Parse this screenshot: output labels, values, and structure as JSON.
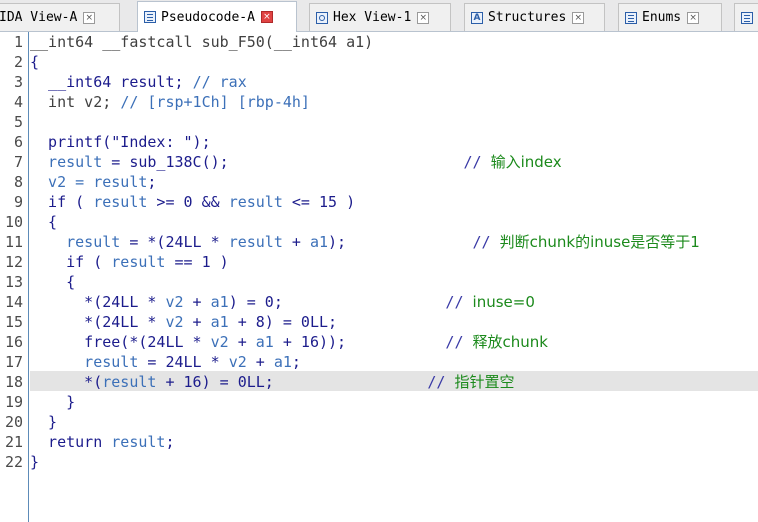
{
  "tabs": [
    {
      "label": "IDA View-A",
      "icon": "none",
      "active": false
    },
    {
      "label": "Pseudocode-A",
      "icon": "document-icon",
      "active": true
    },
    {
      "label": "Hex View-1",
      "icon": "hex-icon",
      "active": false
    },
    {
      "label": "Structures",
      "icon": "structures-icon",
      "active": false
    },
    {
      "label": "Enums",
      "icon": "enums-icon",
      "active": false
    }
  ],
  "code_lines": [
    {
      "n": "1",
      "tokens": [
        {
          "t": "__int64 __fastcall sub_F50(__int64 a1)",
          "c": "muted"
        }
      ]
    },
    {
      "n": "2",
      "tokens": [
        {
          "t": "{",
          "c": "plain"
        }
      ]
    },
    {
      "n": "3",
      "tokens": [
        {
          "t": "  __int64 result; ",
          "c": "plain"
        },
        {
          "t": "// rax",
          "c": "var"
        }
      ]
    },
    {
      "n": "4",
      "tokens": [
        {
          "t": "  int v2; ",
          "c": "muted"
        },
        {
          "t": "// [rsp+1Ch] [rbp-4h]",
          "c": "var"
        }
      ]
    },
    {
      "n": "5",
      "tokens": []
    },
    {
      "n": "6",
      "tokens": [
        {
          "t": "  printf(\"Index: \");",
          "c": "plain"
        }
      ]
    },
    {
      "n": "7",
      "tokens": [
        {
          "t": "  result",
          "c": "var"
        },
        {
          "t": " = sub_138C();",
          "c": "plain"
        },
        {
          "t": "                          // ",
          "c": "com"
        },
        {
          "t": "输入index",
          "c": "cjk"
        }
      ]
    },
    {
      "n": "8",
      "tokens": [
        {
          "t": "  v2 = ",
          "c": "var"
        },
        {
          "t": "result",
          "c": "var"
        },
        {
          "t": ";",
          "c": "plain"
        }
      ]
    },
    {
      "n": "9",
      "tokens": [
        {
          "t": "  if ( ",
          "c": "plain"
        },
        {
          "t": "result",
          "c": "var"
        },
        {
          "t": " >= 0 && ",
          "c": "plain"
        },
        {
          "t": "result",
          "c": "var"
        },
        {
          "t": " <= 15 )",
          "c": "plain"
        }
      ]
    },
    {
      "n": "10",
      "tokens": [
        {
          "t": "  {",
          "c": "plain"
        }
      ]
    },
    {
      "n": "11",
      "tokens": [
        {
          "t": "    result",
          "c": "var"
        },
        {
          "t": " = *(24LL * ",
          "c": "plain"
        },
        {
          "t": "result",
          "c": "var"
        },
        {
          "t": " + ",
          "c": "plain"
        },
        {
          "t": "a1",
          "c": "var"
        },
        {
          "t": ");",
          "c": "plain"
        },
        {
          "t": "              // ",
          "c": "com"
        },
        {
          "t": "判断chunk的inuse是否等于1",
          "c": "cjk"
        }
      ]
    },
    {
      "n": "12",
      "tokens": [
        {
          "t": "    if ( ",
          "c": "plain"
        },
        {
          "t": "result",
          "c": "var"
        },
        {
          "t": " == 1 )",
          "c": "plain"
        }
      ]
    },
    {
      "n": "13",
      "tokens": [
        {
          "t": "    {",
          "c": "plain"
        }
      ]
    },
    {
      "n": "14",
      "tokens": [
        {
          "t": "      *(24LL * ",
          "c": "plain"
        },
        {
          "t": "v2",
          "c": "var"
        },
        {
          "t": " + ",
          "c": "plain"
        },
        {
          "t": "a1",
          "c": "var"
        },
        {
          "t": ") = 0;",
          "c": "plain"
        },
        {
          "t": "                  // ",
          "c": "com"
        },
        {
          "t": "inuse=0",
          "c": "cjk"
        }
      ]
    },
    {
      "n": "15",
      "tokens": [
        {
          "t": "      *(24LL * ",
          "c": "plain"
        },
        {
          "t": "v2",
          "c": "var"
        },
        {
          "t": " + ",
          "c": "plain"
        },
        {
          "t": "a1",
          "c": "var"
        },
        {
          "t": " + 8) = 0LL;",
          "c": "plain"
        }
      ]
    },
    {
      "n": "16",
      "tokens": [
        {
          "t": "      free(*(24LL * ",
          "c": "plain"
        },
        {
          "t": "v2",
          "c": "var"
        },
        {
          "t": " + ",
          "c": "plain"
        },
        {
          "t": "a1",
          "c": "var"
        },
        {
          "t": " + 16));",
          "c": "plain"
        },
        {
          "t": "           // ",
          "c": "com"
        },
        {
          "t": "释放chunk",
          "c": "cjk"
        }
      ]
    },
    {
      "n": "17",
      "tokens": [
        {
          "t": "      result",
          "c": "var"
        },
        {
          "t": " = 24LL * ",
          "c": "plain"
        },
        {
          "t": "v2",
          "c": "var"
        },
        {
          "t": " + ",
          "c": "plain"
        },
        {
          "t": "a1",
          "c": "var"
        },
        {
          "t": ";",
          "c": "plain"
        }
      ]
    },
    {
      "n": "18",
      "tokens": [
        {
          "t": "      *(",
          "c": "plain"
        },
        {
          "t": "result",
          "c": "var"
        },
        {
          "t": " + 16) = 0LL;",
          "c": "plain"
        },
        {
          "t": "                 // ",
          "c": "com"
        },
        {
          "t": "指针置空",
          "c": "cjk"
        }
      ]
    },
    {
      "n": "19",
      "tokens": [
        {
          "t": "    }",
          "c": "plain"
        }
      ]
    },
    {
      "n": "20",
      "tokens": [
        {
          "t": "  }",
          "c": "plain"
        }
      ]
    },
    {
      "n": "21",
      "tokens": [
        {
          "t": "  return ",
          "c": "plain"
        },
        {
          "t": "result",
          "c": "var"
        },
        {
          "t": ";",
          "c": "plain"
        }
      ]
    },
    {
      "n": "22",
      "tokens": [
        {
          "t": "}",
          "c": "plain"
        }
      ]
    }
  ],
  "highlighted_line": "18"
}
